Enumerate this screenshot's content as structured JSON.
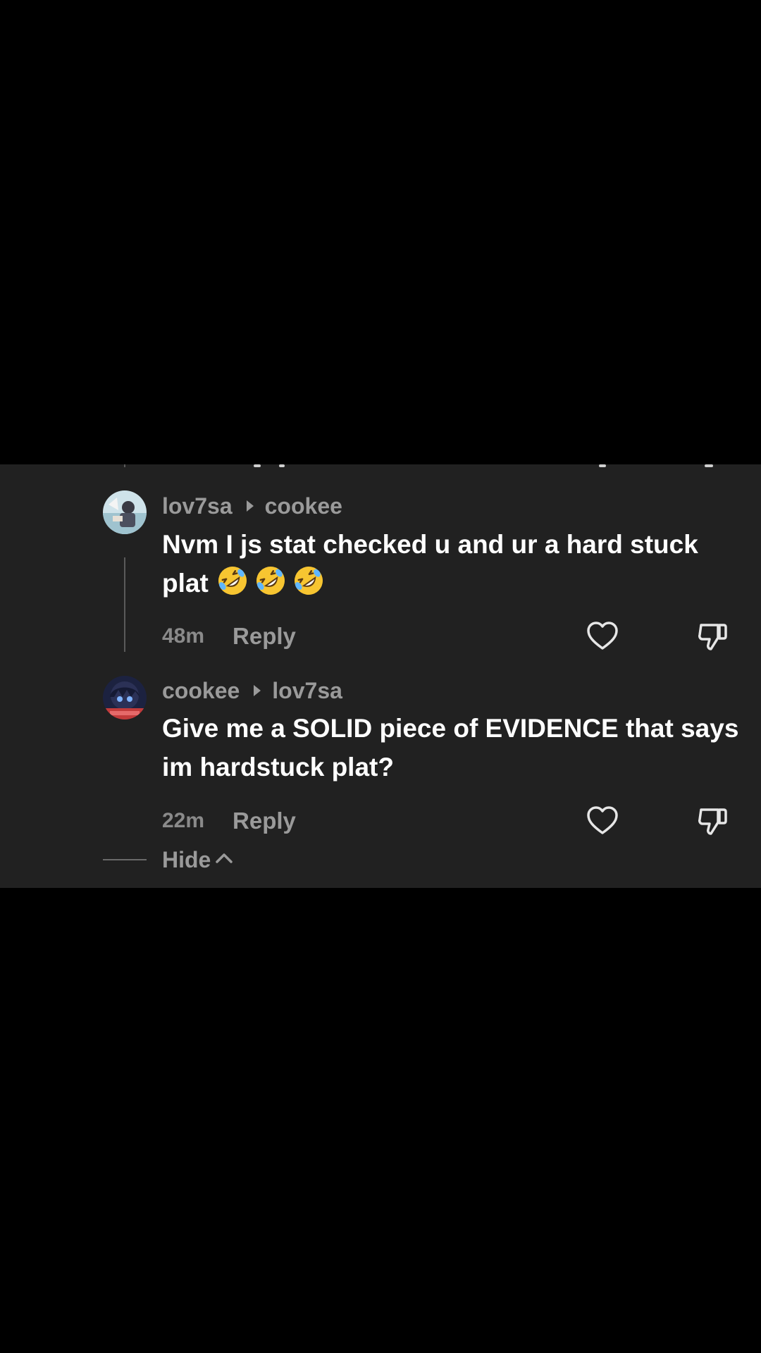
{
  "comments": [
    {
      "author": "lov7sa",
      "reply_to": "cookee",
      "text": "Nvm I js stat checked u and ur a hard stuck plat",
      "emojis": [
        "rolling-on-floor-laughing",
        "rolling-on-floor-laughing",
        "rolling-on-floor-laughing"
      ],
      "time": "48m",
      "reply_label": "Reply"
    },
    {
      "author": "cookee",
      "reply_to": "lov7sa",
      "text": "Give me a SOLID piece of EVIDENCE that says im hardstuck plat?",
      "time": "22m",
      "reply_label": "Reply"
    }
  ],
  "thread": {
    "hide_label": "Hide"
  },
  "colors": {
    "background": "#000000",
    "panel": "#212121",
    "text_primary": "#ffffff",
    "text_secondary": "#9a9a9a"
  },
  "icons": [
    "heart-icon",
    "dislike-icon",
    "chevron-up-icon",
    "caret-right-icon"
  ]
}
